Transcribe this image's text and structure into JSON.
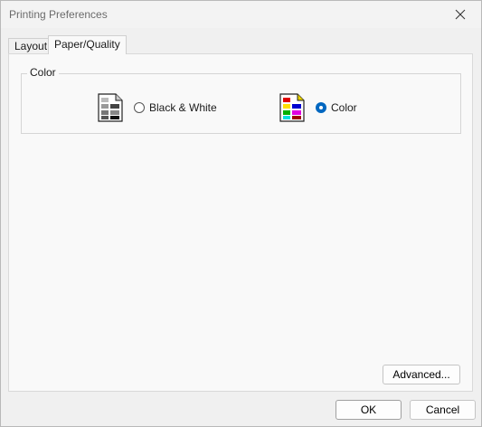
{
  "window": {
    "title": "Printing Preferences"
  },
  "tabs": [
    {
      "label": "Layout",
      "active": false
    },
    {
      "label": "Paper/Quality",
      "active": true
    }
  ],
  "color_group": {
    "legend": "Color",
    "options": [
      {
        "label": "Black & White",
        "checked": false,
        "icon": "grayscale-document-icon"
      },
      {
        "label": "Color",
        "checked": true,
        "icon": "color-document-icon"
      }
    ]
  },
  "buttons": {
    "advanced": "Advanced...",
    "ok": "OK",
    "cancel": "Cancel"
  },
  "colors": {
    "accent": "#0067c0"
  }
}
